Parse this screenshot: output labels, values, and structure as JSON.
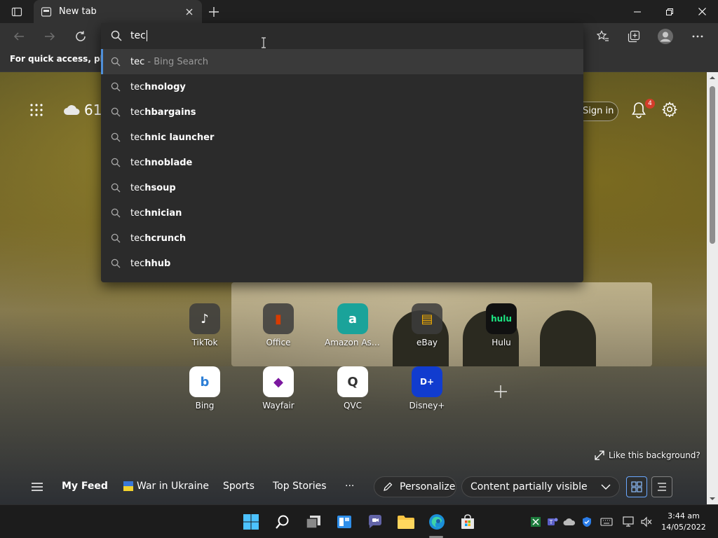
{
  "browser": {
    "tab_label": "New tab",
    "favbar_text": "For quick access, place y"
  },
  "omnibox": {
    "value": "tec",
    "suggestions": [
      {
        "typed": "tec",
        "rest": "",
        "hint": " - Bing Search"
      },
      {
        "typed": "tec",
        "rest": "hnology",
        "hint": ""
      },
      {
        "typed": "tec",
        "rest": "hbargains",
        "hint": ""
      },
      {
        "typed": "tec",
        "rest": "hnic launcher",
        "hint": ""
      },
      {
        "typed": "tec",
        "rest": "hnoblade",
        "hint": ""
      },
      {
        "typed": "tec",
        "rest": "hsoup",
        "hint": ""
      },
      {
        "typed": "tec",
        "rest": "hnician",
        "hint": ""
      },
      {
        "typed": "tec",
        "rest": "hcrunch",
        "hint": ""
      },
      {
        "typed": "tec",
        "rest": "hhub",
        "hint": ""
      }
    ]
  },
  "newtab": {
    "weather_temp": "61",
    "signin_label": "Sign in",
    "notification_count": "4",
    "tiles": [
      {
        "label": "TikTok",
        "glyph": "♪",
        "color": "#111111"
      },
      {
        "label": "Office",
        "glyph": "▮",
        "color": "#d83b01"
      },
      {
        "label": "Amazon Assi...",
        "glyph": "a",
        "color": "#1aa39a"
      },
      {
        "label": "eBay",
        "glyph": "▤",
        "color": "#e53238"
      },
      {
        "label": "Hulu",
        "glyph": "hulu",
        "color": "#1ce783"
      },
      {
        "label": "Bing",
        "glyph": "b",
        "color": "#2d7fd6"
      },
      {
        "label": "Wayfair",
        "glyph": "◆",
        "color": "#7b189f"
      },
      {
        "label": "QVC",
        "glyph": "Q",
        "color": "#ffffff"
      },
      {
        "label": "Disney+",
        "glyph": "D+",
        "color": "#113ccf"
      }
    ],
    "like_background": "Like this background?",
    "feed": {
      "my_feed": "My Feed",
      "war_in_ukraine": "War in Ukraine",
      "sports": "Sports",
      "top_stories": "Top Stories",
      "more": "···",
      "personalize": "Personalize",
      "content_visibility": "Content partially visible"
    }
  },
  "taskbar": {
    "time": "3:44 am",
    "date": "14/05/2022"
  }
}
